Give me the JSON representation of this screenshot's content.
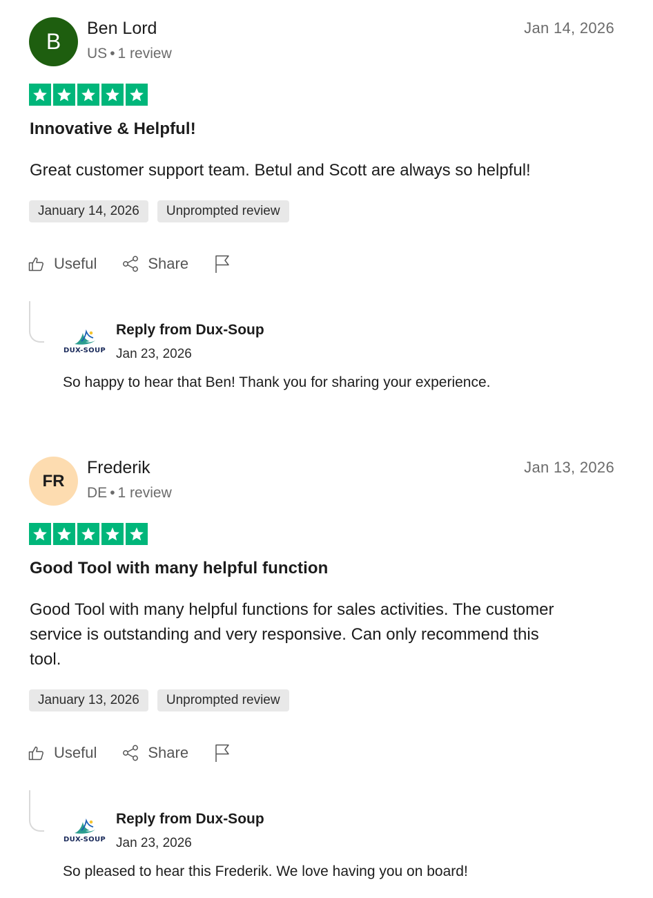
{
  "colors": {
    "star_green": "#00b67a",
    "avatar_green": "#1e5e0f",
    "avatar_peach": "#fddcb0",
    "tag_bg": "#e8e8e8"
  },
  "reviews": [
    {
      "avatar_initials": "B",
      "name": "Ben Lord",
      "country": "US",
      "separator": "•",
      "review_count": "1 review",
      "date": "Jan 14, 2026",
      "rating": 5,
      "title": "Innovative & Helpful!",
      "body": "Great customer support team. Betul and Scott are always so helpful!",
      "tags": [
        "January 14, 2026",
        "Unprompted review"
      ],
      "actions": {
        "useful": "Useful",
        "share": "Share"
      },
      "reply": {
        "logo_text": "DUX-SOUP",
        "title": "Reply from Dux-Soup",
        "date": "Jan 23, 2026",
        "text": "So happy to hear that Ben! Thank you for sharing your experience."
      }
    },
    {
      "avatar_initials": "FR",
      "name": "Frederik",
      "country": "DE",
      "separator": "•",
      "review_count": "1 review",
      "date": "Jan 13, 2026",
      "rating": 5,
      "title": "Good Tool with many helpful function",
      "body": "Good Tool with many helpful functions for sales activities. The customer service is outstanding and very responsive. Can only recommend this tool.",
      "tags": [
        "January 13, 2026",
        "Unprompted review"
      ],
      "actions": {
        "useful": "Useful",
        "share": "Share"
      },
      "reply": {
        "logo_text": "DUX-SOUP",
        "title": "Reply from Dux-Soup",
        "date": "Jan 23, 2026",
        "text": "So pleased to hear this Frederik. We love having you on board!"
      }
    }
  ]
}
